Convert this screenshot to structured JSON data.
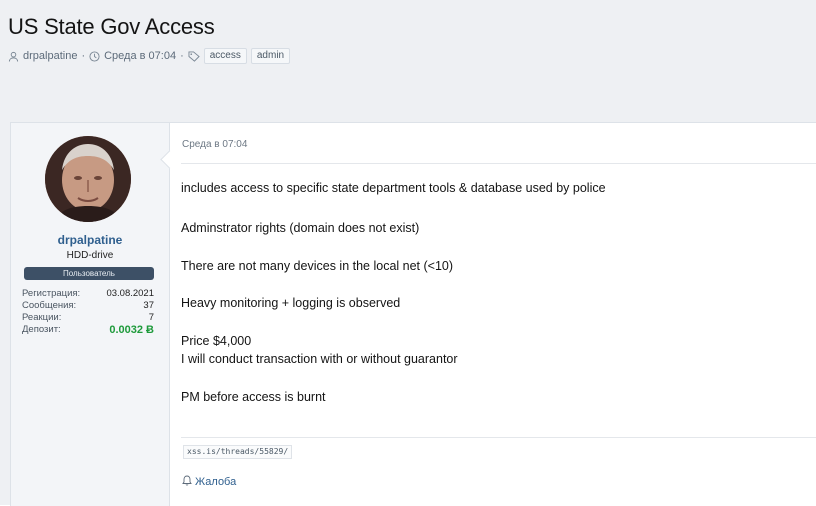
{
  "thread": {
    "title": "US State Gov Access",
    "author": "drpalpatine",
    "date": "Среда в 07:04",
    "separator": "·",
    "tags": [
      "access",
      "admin"
    ]
  },
  "user": {
    "name": "drpalpatine",
    "title": "HDD-drive",
    "banner": "Пользователь",
    "stats": [
      {
        "label": "Регистрация:",
        "value": "03.08.2021"
      },
      {
        "label": "Сообщения:",
        "value": "37"
      },
      {
        "label": "Реакции:",
        "value": "7"
      },
      {
        "label": "Депозит:",
        "value": "0.0032 Ƀ"
      }
    ]
  },
  "post": {
    "date": "Среда в 07:04",
    "lines": [
      "includes access to specific state department tools & database used by police",
      "Adminstrator rights (domain does not exist)",
      "There are not many devices in the local net (<10)",
      "Heavy monitoring + logging is observed",
      "Price $4,000",
      "I will conduct transaction with or without guarantor",
      "PM before access is burnt"
    ],
    "link": "xss.is/threads/55829/",
    "report_label": "Жалоба"
  },
  "colors": {
    "username": "#2f5f8e",
    "banner_bg": "#3d5066",
    "deposit": "#1e9a3b"
  },
  "icons": [
    "user-icon",
    "clock-icon",
    "tag-icon",
    "bell-icon"
  ]
}
